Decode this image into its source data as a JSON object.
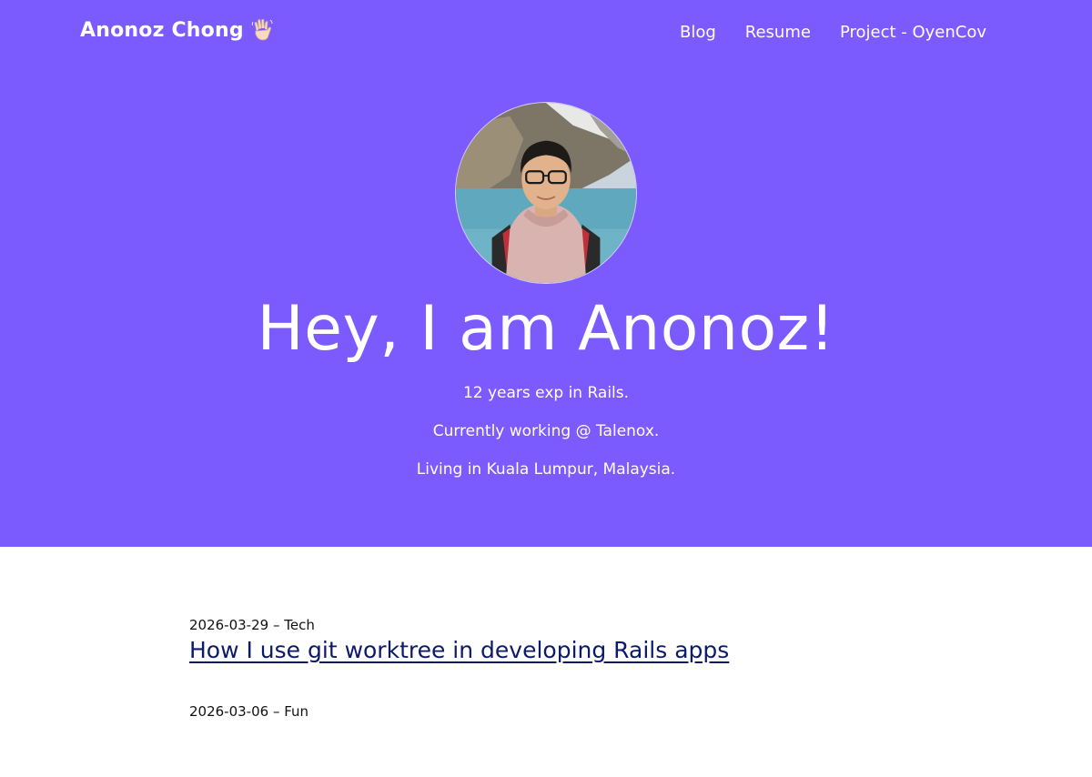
{
  "header": {
    "brand_name": "Anonoz Chong",
    "brand_icon": "waving-hand-icon",
    "nav": [
      {
        "label": "Blog"
      },
      {
        "label": "Resume"
      },
      {
        "label": "Project - OyenCov"
      }
    ]
  },
  "hero": {
    "headline": "Hey, I am Anonoz!",
    "bio": [
      "12 years exp in Rails.",
      "Currently working @ Talenox.",
      "Living in Kuala Lumpur, Malaysia."
    ],
    "background_color": "#7b5bfd"
  },
  "posts": [
    {
      "date": "2026-03-29",
      "category": "Tech",
      "title": "How I use git worktree in developing Rails apps"
    },
    {
      "date": "2026-03-06",
      "category": "Fun",
      "title": ""
    }
  ],
  "colors": {
    "hero_bg": "#7b5bfd",
    "link": "#0c1a6b"
  }
}
